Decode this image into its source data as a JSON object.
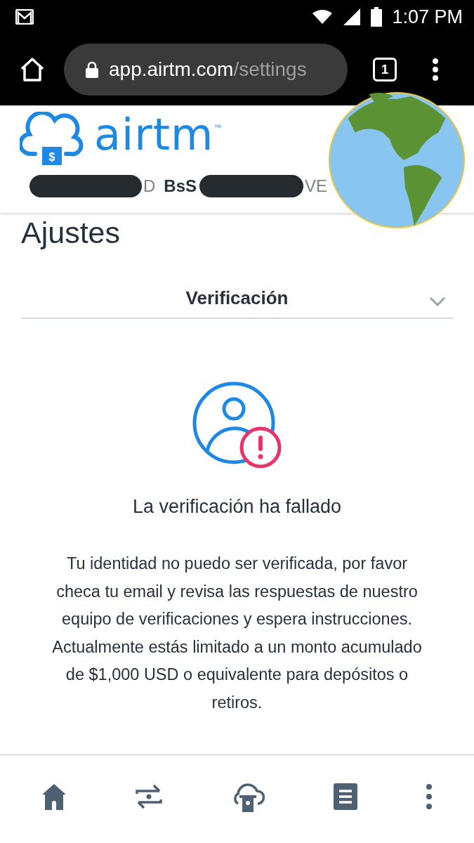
{
  "status_bar": {
    "time": "1:07 PM"
  },
  "browser": {
    "url_host": "app.airtm.com",
    "url_path": "/settings",
    "tab_count": "1"
  },
  "header": {
    "logo_text": "airtm",
    "trademark": "™",
    "logo_badge": "$",
    "balance_parts": [
      "D",
      "BsS",
      "VE"
    ]
  },
  "page_title": "Ajustes",
  "section_select": {
    "label": "Verificación"
  },
  "status": {
    "kind": "failed",
    "title": "La verificación ha fallado",
    "message": "Tu identidad no puedo ser verificada, por favor checa tu email y revisa las respuestas de nuestro equipo de verificaciones y espera instrucciones. Actualmente estás limitado a un monto acumulado de $1,000 USD o equivalente para depósitos o retiros."
  },
  "bottom_nav": [
    {
      "kind": "home"
    },
    {
      "kind": "exchange"
    },
    {
      "kind": "deposit"
    },
    {
      "kind": "list"
    },
    {
      "kind": "more"
    }
  ]
}
